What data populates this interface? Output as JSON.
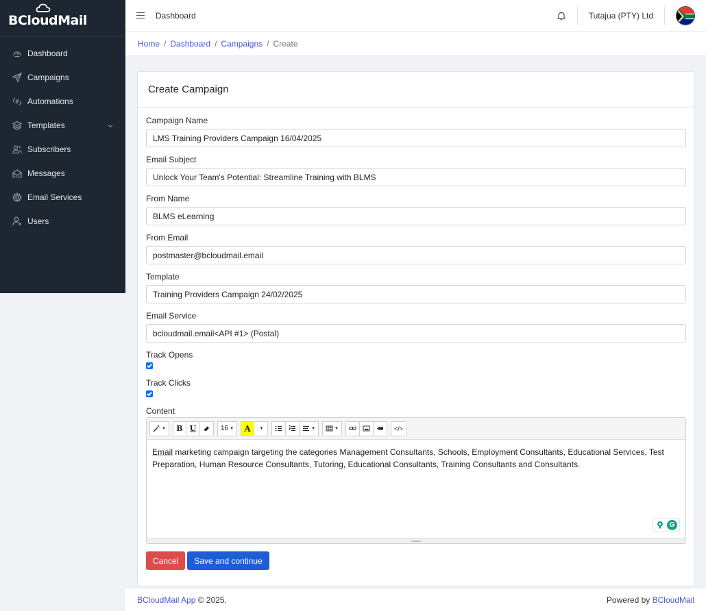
{
  "brand": {
    "name": "BCloudMail"
  },
  "sidebar": {
    "items": [
      {
        "label": "Dashboard",
        "icon": "gauge-icon"
      },
      {
        "label": "Campaigns",
        "icon": "send-icon"
      },
      {
        "label": "Automations",
        "icon": "sync-icon"
      },
      {
        "label": "Templates",
        "icon": "layers-icon",
        "has_submenu": true
      },
      {
        "label": "Subscribers",
        "icon": "users-icon"
      },
      {
        "label": "Messages",
        "icon": "envelope-icon"
      },
      {
        "label": "Email Services",
        "icon": "gear-icon"
      },
      {
        "label": "Users",
        "icon": "user-add-icon"
      }
    ]
  },
  "topbar": {
    "title": "Dashboard",
    "company": "Tutajua (PTY) Ltd"
  },
  "breadcrumb": {
    "home": "Home",
    "dashboard": "Dashboard",
    "campaigns": "Campaigns",
    "current": "Create",
    "separator": "/"
  },
  "card": {
    "title": "Create Campaign"
  },
  "form": {
    "campaign_name": {
      "label": "Campaign Name",
      "value": "LMS Training Providers Campaign 16/04/2025"
    },
    "email_subject": {
      "label": "Email Subject",
      "value": "Unlock Your Team's Potential: Streamline Training with BLMS"
    },
    "from_name": {
      "label": "From Name",
      "value": "BLMS eLearning"
    },
    "from_email": {
      "label": "From Email",
      "value": "postmaster@bcloudmail.email"
    },
    "template": {
      "label": "Template",
      "value": "Training Providers Campaign 24/02/2025"
    },
    "email_service": {
      "label": "Email Service",
      "value": "bcloudmail.email<API #1> (Postal)"
    },
    "track_opens": {
      "label": "Track Opens",
      "checked": true
    },
    "track_clicks": {
      "label": "Track Clicks",
      "checked": true
    },
    "content": {
      "label": "Content",
      "font_size": "16",
      "first_word": "Email",
      "text": " marketing campaign targeting the categories Management Consultants, Schools, Employment Consultants, Educational Services, Test Preparation, Human Resource Consultants, Tutoring, Educational Consultants, Training Consultants and Consultants."
    }
  },
  "buttons": {
    "cancel": "Cancel",
    "save": "Save and continue"
  },
  "footer": {
    "app_link": "BCloudMail App",
    "copyright": "© 2025.",
    "powered_text": "Powered by",
    "powered_link": "BCloudMail"
  },
  "colors": {
    "sidebar_bg": "#1d2631",
    "link": "#4b55d6",
    "cancel": "#dc4c4c",
    "save": "#1d5ed6",
    "checkbox": "#0d6efd"
  }
}
